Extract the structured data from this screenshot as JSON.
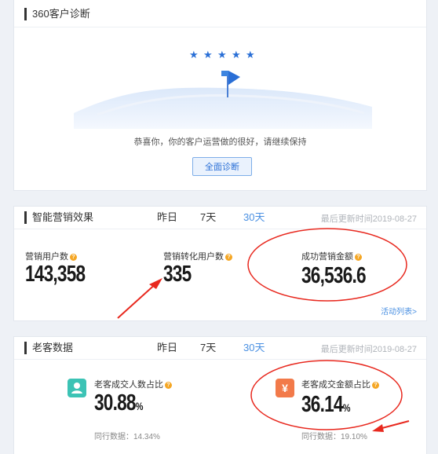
{
  "diagnosis": {
    "title": "360客户诊断",
    "message": "恭喜你，你的客户运营做的很好，请继续保持",
    "button_label": "全面诊断",
    "stars": 5
  },
  "marketing": {
    "title": "智能营销效果",
    "tabs": [
      "昨日",
      "7天",
      "30天"
    ],
    "active_tab": "30天",
    "updated": "最后更新时间2019-08-27",
    "metrics": [
      {
        "label": "营销用户数",
        "value": "143,358"
      },
      {
        "label": "营销转化用户数",
        "value": "335"
      },
      {
        "label": "成功营销金额",
        "value": "36,536.6"
      }
    ],
    "activity_link": "活动列表>"
  },
  "returning": {
    "title": "老客数据",
    "tabs": [
      "昨日",
      "7天",
      "30天"
    ],
    "active_tab": "30天",
    "updated": "最后更新时间2019-08-27",
    "metrics": [
      {
        "label": "老客成交人数占比",
        "value": "30.88",
        "unit": "%",
        "peer": "同行数据：14.34%",
        "icon": "user-icon",
        "icon_color": "#3cc3b5"
      },
      {
        "label": "老客成交金额占比",
        "value": "36.14",
        "unit": "%",
        "peer": "同行数据：19.10%",
        "icon": "yen-icon",
        "icon_color": "#f27a4a"
      }
    ]
  },
  "colors": {
    "accent": "#4a90e2",
    "help": "#f5a623",
    "annotation": "#e8281e"
  }
}
